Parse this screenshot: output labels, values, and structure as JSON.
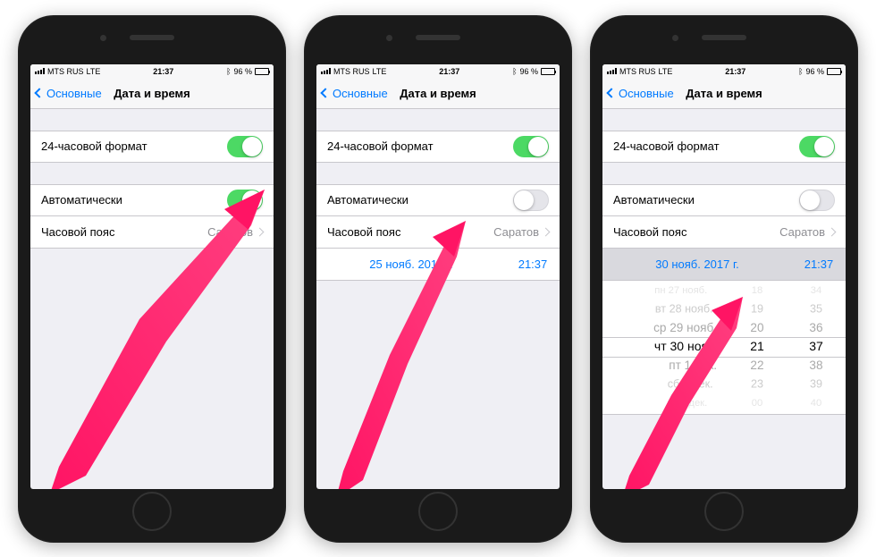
{
  "statusBar": {
    "carrier": "MTS RUS",
    "network": "LTE",
    "time": "21:37",
    "batteryPercent": "96 %"
  },
  "nav": {
    "back": "Основные",
    "title": "Дата и время"
  },
  "rows": {
    "format24": "24-часовой формат",
    "auto": "Автоматически",
    "timezone": "Часовой пояс",
    "timezoneValue": "Саратов"
  },
  "phone2": {
    "date": "25 нояб. 2017 г.",
    "time": "21:37"
  },
  "phone3": {
    "date": "30 нояб. 2017 г.",
    "time": "21:37",
    "picker": {
      "day": [
        "пн 27 нояб.",
        "вт 28 нояб.",
        "ср 29 нояб.",
        "чт 30 нояб.",
        "пт 1 дек.",
        "сб 2 дек.",
        "вс 3 дек."
      ],
      "hour": [
        "18",
        "19",
        "20",
        "21",
        "22",
        "23",
        "00"
      ],
      "min": [
        "34",
        "35",
        "36",
        "37",
        "38",
        "39",
        "40"
      ]
    }
  },
  "colors": {
    "accent": "#007aff",
    "toggleOn": "#4cd964",
    "arrow": "#ff1464"
  }
}
